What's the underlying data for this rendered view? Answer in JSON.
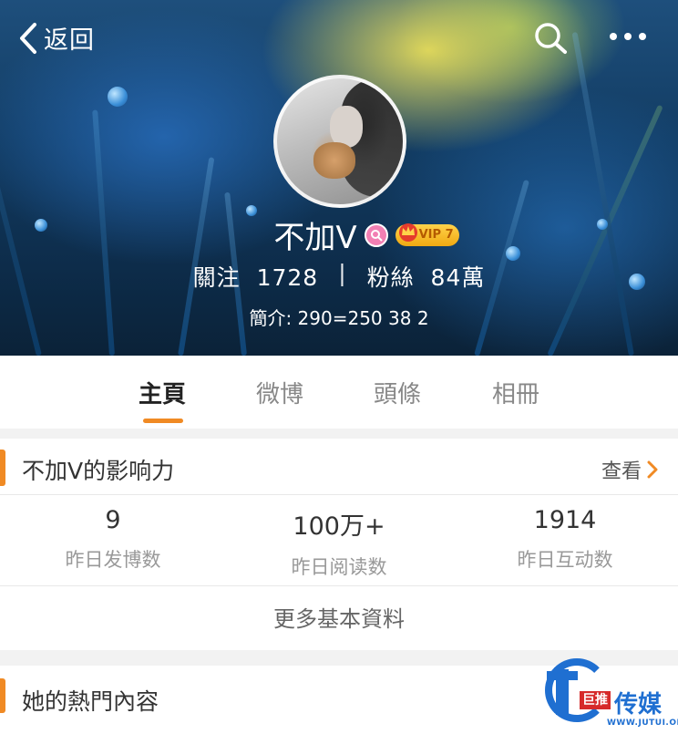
{
  "nav": {
    "back_label": "返回"
  },
  "profile": {
    "name": "不加V",
    "vip_label": "VIP 7",
    "following_label": "關注",
    "following_count": "1728",
    "separator": "|",
    "followers_label": "粉絲",
    "followers_count": "84萬",
    "bio": "簡介: 290=250 38 2"
  },
  "tabs": [
    {
      "label": "主頁",
      "active": true
    },
    {
      "label": "微博",
      "active": false
    },
    {
      "label": "頭條",
      "active": false
    },
    {
      "label": "相冊",
      "active": false
    }
  ],
  "influence": {
    "title": "不加V的影响力",
    "view_label": "查看",
    "metrics": [
      {
        "value": "9",
        "label": "昨日发博数"
      },
      {
        "value": "100万+",
        "label": "昨日阅读数"
      },
      {
        "value": "1914",
        "label": "昨日互动数"
      }
    ],
    "more_label": "更多基本資料"
  },
  "hot": {
    "title": "她的熱門內容"
  },
  "watermark": {
    "badge": "巨推",
    "text": "传媒",
    "url": "WWW.JUTUI.ORG"
  },
  "colors": {
    "accent": "#f08a24",
    "vip_gold": "#f0a912",
    "verify_pink": "#f27fb3",
    "watermark_blue": "#1f6fd1"
  },
  "icons": [
    "back-chevron-icon",
    "search-icon",
    "more-icon",
    "verify-icon",
    "crown-icon",
    "chevron-right-icon"
  ]
}
